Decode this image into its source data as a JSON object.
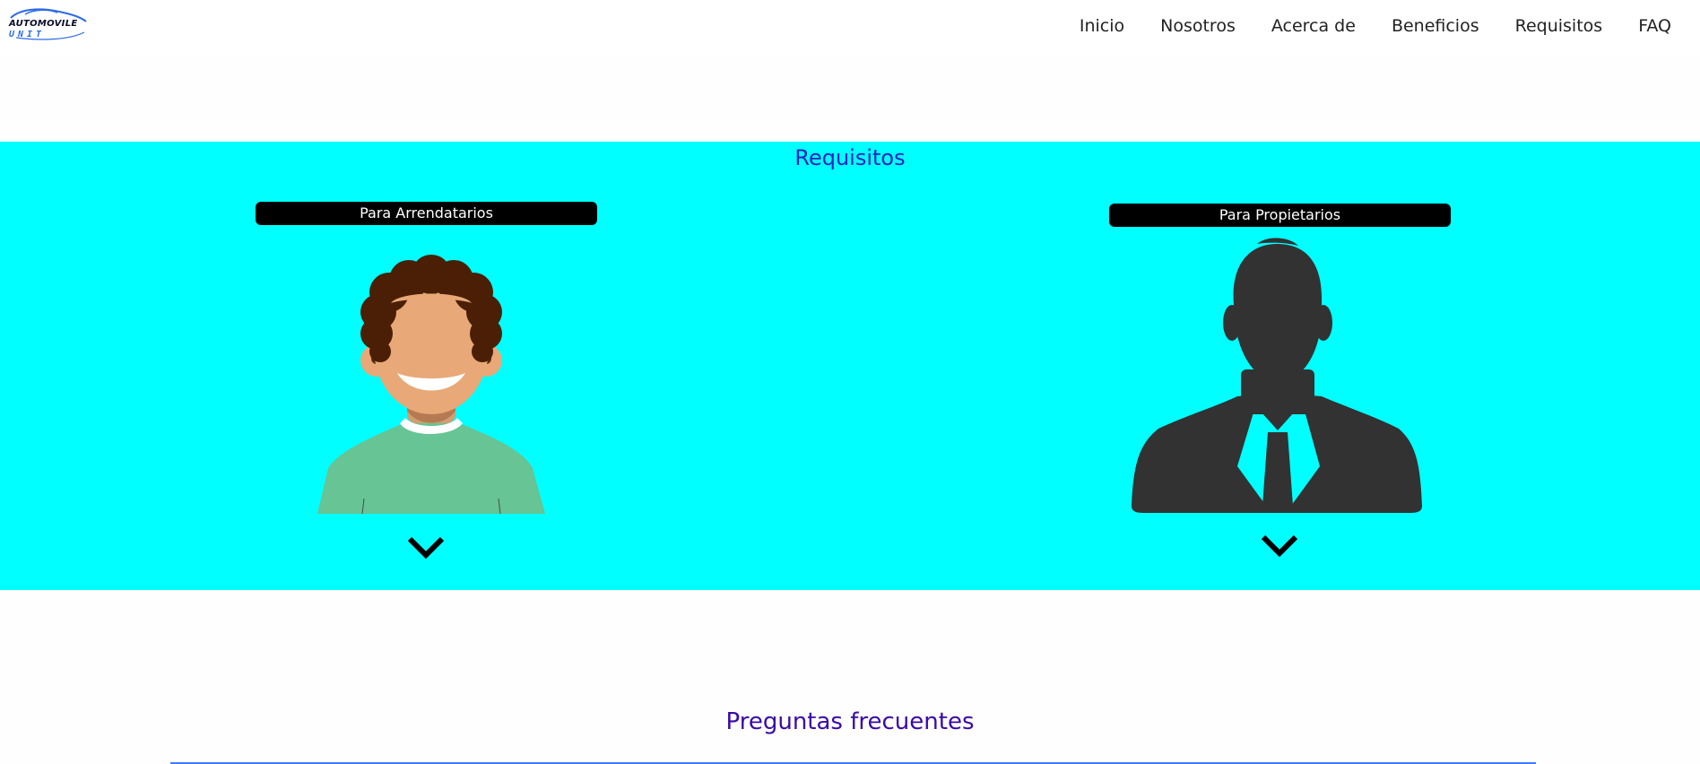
{
  "brand": {
    "line1": "AUTOMOVILE",
    "line2": "UNIT"
  },
  "nav": [
    {
      "label": "Inicio"
    },
    {
      "label": "Nosotros"
    },
    {
      "label": "Acerca de"
    },
    {
      "label": "Beneficios"
    },
    {
      "label": "Requisitos"
    },
    {
      "label": "FAQ"
    }
  ],
  "requisitos": {
    "title": "Requisitos",
    "cards": [
      {
        "label": "Para Arrendatarios",
        "avatar_icon": "tenant-avatar-icon",
        "toggle_icon": "chevron-down-icon"
      },
      {
        "label": "Para Propietarios",
        "avatar_icon": "owner-silhouette-icon",
        "toggle_icon": "chevron-down-icon"
      }
    ]
  },
  "faq": {
    "title": "Preguntas frecuentes"
  },
  "colors": {
    "section_bg": "#00ffff",
    "requisitos_title": "#2222c0",
    "faq_title": "#3a0aa8",
    "divider": "#3d7bff",
    "pill_bg": "#000000"
  }
}
